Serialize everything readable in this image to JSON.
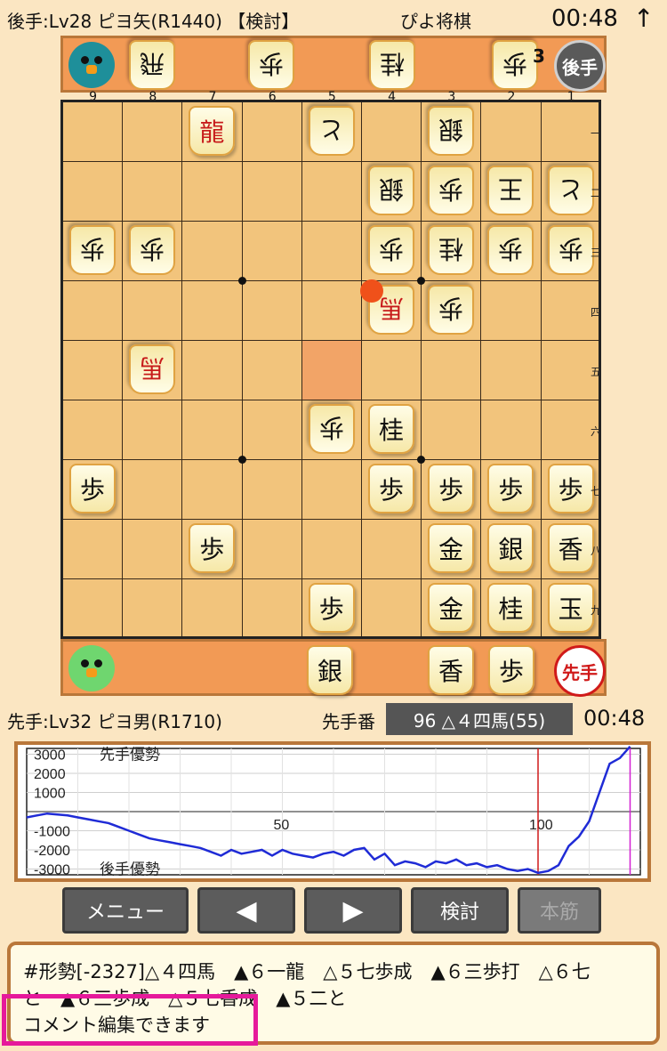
{
  "top_bar": {
    "title": "後手:Lv28 ピヨ矢(R1440) 【検討】",
    "app_name": "ぴよ将棋",
    "clock": "00:48",
    "arrow": "↑"
  },
  "gote_stand": {
    "badge": "後手",
    "pieces": [
      {
        "label": "飛"
      },
      {
        "label": "歩"
      },
      {
        "label": "桂"
      },
      {
        "label": "歩",
        "count": "3"
      }
    ]
  },
  "sente_stand": {
    "badge": "先手",
    "pieces": [
      {
        "label": "銀"
      },
      {
        "label": "香"
      },
      {
        "label": "歩"
      }
    ]
  },
  "board": {
    "file_labels": [
      "9",
      "8",
      "7",
      "6",
      "5",
      "4",
      "3",
      "2",
      "1"
    ],
    "rank_labels": [
      "一",
      "二",
      "三",
      "四",
      "五",
      "六",
      "七",
      "八",
      "九"
    ],
    "last_move_square": {
      "file": 5,
      "rank": 5
    },
    "pieces": [
      {
        "file": 7,
        "rank": 1,
        "label": "龍",
        "owner": "sente",
        "promoted": true
      },
      {
        "file": 5,
        "rank": 1,
        "label": "と",
        "owner": "gote",
        "promoted": false
      },
      {
        "file": 3,
        "rank": 1,
        "label": "銀",
        "owner": "gote",
        "promoted": false
      },
      {
        "file": 4,
        "rank": 2,
        "label": "銀",
        "owner": "gote",
        "promoted": false
      },
      {
        "file": 3,
        "rank": 2,
        "label": "歩",
        "owner": "gote",
        "promoted": false
      },
      {
        "file": 2,
        "rank": 2,
        "label": "王",
        "owner": "gote",
        "promoted": false
      },
      {
        "file": 1,
        "rank": 2,
        "label": "と",
        "owner": "gote",
        "promoted": false
      },
      {
        "file": 9,
        "rank": 3,
        "label": "歩",
        "owner": "gote",
        "promoted": false
      },
      {
        "file": 8,
        "rank": 3,
        "label": "歩",
        "owner": "gote",
        "promoted": false
      },
      {
        "file": 4,
        "rank": 3,
        "label": "歩",
        "owner": "gote",
        "promoted": false
      },
      {
        "file": 3,
        "rank": 3,
        "label": "桂",
        "owner": "gote",
        "promoted": false
      },
      {
        "file": 2,
        "rank": 3,
        "label": "歩",
        "owner": "gote",
        "promoted": false
      },
      {
        "file": 1,
        "rank": 3,
        "label": "歩",
        "owner": "gote",
        "promoted": false
      },
      {
        "file": 4,
        "rank": 4,
        "label": "馬",
        "owner": "gote",
        "promoted": true
      },
      {
        "file": 3,
        "rank": 4,
        "label": "歩",
        "owner": "gote",
        "promoted": false
      },
      {
        "file": 8,
        "rank": 5,
        "label": "馬",
        "owner": "gote",
        "promoted": true
      },
      {
        "file": 5,
        "rank": 6,
        "label": "歩",
        "owner": "gote",
        "promoted": false
      },
      {
        "file": 4,
        "rank": 6,
        "label": "桂",
        "owner": "sente",
        "promoted": false
      },
      {
        "file": 9,
        "rank": 7,
        "label": "歩",
        "owner": "sente",
        "promoted": false
      },
      {
        "file": 4,
        "rank": 7,
        "label": "歩",
        "owner": "sente",
        "promoted": false
      },
      {
        "file": 3,
        "rank": 7,
        "label": "歩",
        "owner": "sente",
        "promoted": false
      },
      {
        "file": 2,
        "rank": 7,
        "label": "歩",
        "owner": "sente",
        "promoted": false
      },
      {
        "file": 1,
        "rank": 7,
        "label": "歩",
        "owner": "sente",
        "promoted": false
      },
      {
        "file": 7,
        "rank": 8,
        "label": "歩",
        "owner": "sente",
        "promoted": false
      },
      {
        "file": 3,
        "rank": 8,
        "label": "金",
        "owner": "sente",
        "promoted": false
      },
      {
        "file": 2,
        "rank": 8,
        "label": "銀",
        "owner": "sente",
        "promoted": false
      },
      {
        "file": 1,
        "rank": 8,
        "label": "香",
        "owner": "sente",
        "promoted": false
      },
      {
        "file": 5,
        "rank": 9,
        "label": "歩",
        "owner": "sente",
        "promoted": false
      },
      {
        "file": 3,
        "rank": 9,
        "label": "金",
        "owner": "sente",
        "promoted": false
      },
      {
        "file": 2,
        "rank": 9,
        "label": "桂",
        "owner": "sente",
        "promoted": false
      },
      {
        "file": 1,
        "rank": 9,
        "label": "玉",
        "owner": "sente",
        "promoted": false
      }
    ]
  },
  "status": {
    "player": "先手:Lv32 ピヨ男(R1710)",
    "turn": "先手番",
    "move": "96 △４四馬(55)",
    "clock": "00:48"
  },
  "chart_data": {
    "type": "line",
    "ylim": [
      -3300,
      3300
    ],
    "xlim": [
      0,
      120
    ],
    "yticks": [
      "3000",
      "2000",
      "1000",
      "-1000",
      "-2000",
      "-3000"
    ],
    "xtick_labels": [
      "50",
      "100"
    ],
    "annotations": {
      "top": "先手優勢",
      "bottom": "後手優勢"
    },
    "current_move_marker": 100,
    "end_marker": 118,
    "series": [
      {
        "color": "#1f2bd6",
        "x": [
          0,
          2,
          4,
          6,
          8,
          10,
          12,
          14,
          16,
          18,
          20,
          22,
          24,
          26,
          28,
          30,
          32,
          34,
          36,
          38,
          40,
          42,
          44,
          46,
          48,
          50,
          52,
          54,
          56,
          58,
          60,
          62,
          64,
          66,
          68,
          70,
          72,
          74,
          76,
          78,
          80,
          82,
          84,
          86,
          88,
          90,
          92,
          94,
          96,
          98,
          100,
          102,
          104,
          106,
          108,
          110,
          112,
          114,
          116,
          118
        ],
        "y": [
          -300,
          -200,
          -100,
          -150,
          -200,
          -300,
          -400,
          -500,
          -600,
          -800,
          -1000,
          -1200,
          -1400,
          -1500,
          -1600,
          -1700,
          -1800,
          -1900,
          -2100,
          -2300,
          -2000,
          -2200,
          -2100,
          -2000,
          -2300,
          -2000,
          -2200,
          -2300,
          -2400,
          -2200,
          -2100,
          -2300,
          -2000,
          -1900,
          -2500,
          -2200,
          -2800,
          -2600,
          -2700,
          -2900,
          -2600,
          -2700,
          -2500,
          -2800,
          -2700,
          -2900,
          -2800,
          -3000,
          -3100,
          -3000,
          -3200,
          -3100,
          -2800,
          -1800,
          -1300,
          -500,
          1000,
          2500,
          2800,
          3400
        ]
      }
    ]
  },
  "buttons": [
    {
      "label": "メニュー",
      "enabled": true
    },
    {
      "icon": "arrow-left-icon",
      "label": "◀",
      "enabled": true
    },
    {
      "icon": "arrow-right-icon",
      "label": "▶",
      "enabled": true
    },
    {
      "label": "検討",
      "enabled": true
    },
    {
      "label": "本筋",
      "enabled": false
    }
  ],
  "comment": {
    "line1": "#形勢[-2327]△４四馬　▲６一龍　△５七歩成　▲６三歩打　△６七",
    "line2": "と　▲６三歩成　△５七香成　▲５二と",
    "edit_hint": "コメント編集できます"
  },
  "colors": {
    "background": "#fbe6c2",
    "board": "#f2c47c",
    "stand": "#f29a55",
    "eval_line": "#1f2bd6",
    "marker": "#d01a1a",
    "end_marker": "#d21ed2",
    "edit_hint_border": "#e6199b"
  }
}
